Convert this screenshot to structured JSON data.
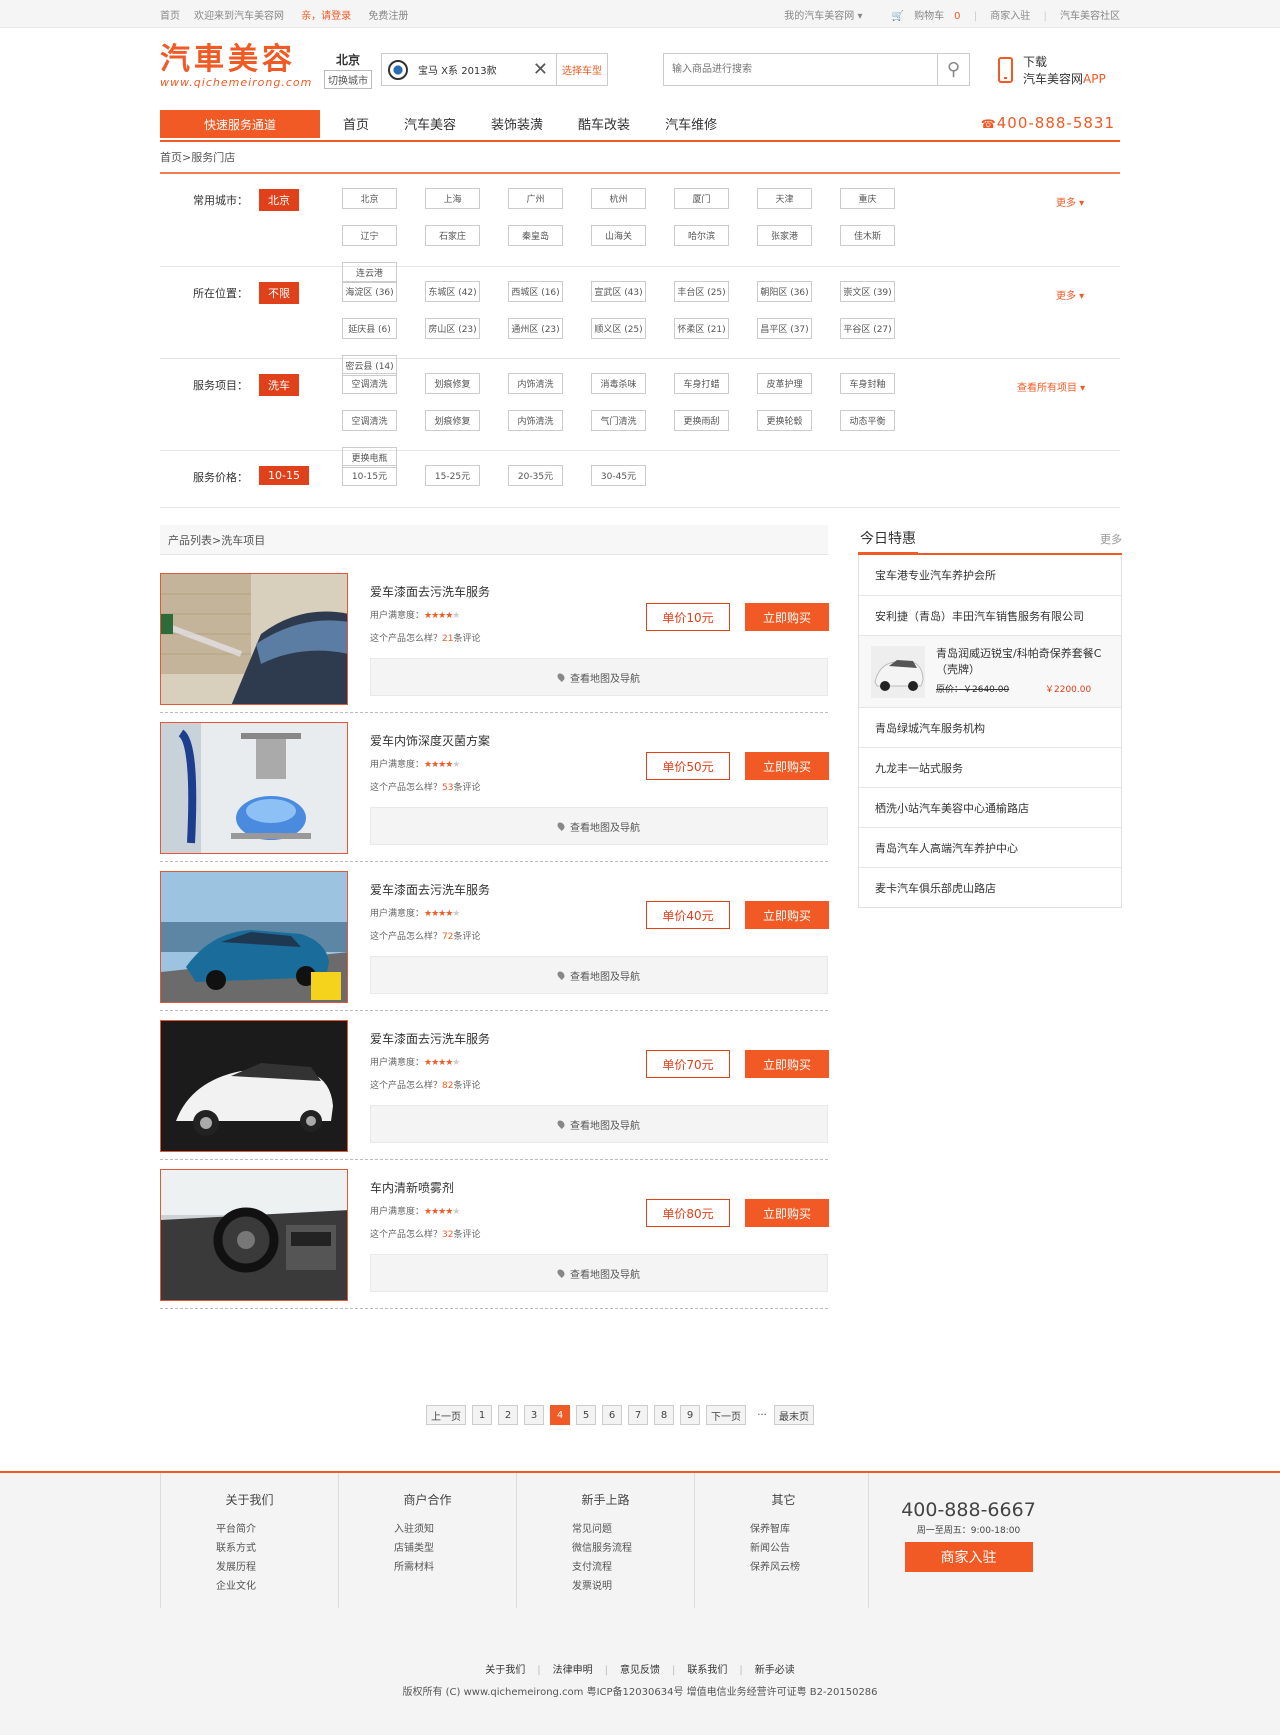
{
  "topbar": {
    "home": "首页",
    "welcome": "欢迎来到汽车美容网",
    "login": "亲，请登录",
    "register": "免费注册",
    "my_site": "我的汽车美容网",
    "cart": "购物车",
    "cart_count": "0",
    "merchant": "商家入驻",
    "community": "汽车美容社区"
  },
  "header": {
    "logo_text": "汽車美容",
    "logo_url": "www.qichemeirong.com",
    "city": "北京",
    "switch_city": "切换城市",
    "car": "宝马 X系 2013款",
    "choose_car": "选择车型",
    "search_placeholder": "输入商品进行搜索",
    "download": "下载",
    "app_name": "汽车美容网",
    "app_suffix": "APP"
  },
  "nav": {
    "quick": "快速服务通道",
    "items": [
      "首页",
      "汽车美容",
      "装饰装潢",
      "酷车改装",
      "汽车维修"
    ],
    "tel": "400-888-5831"
  },
  "breadcrumb": "首页>服务门店",
  "filters": {
    "city": {
      "label": "常用城市：",
      "active": "北京",
      "more": "更多",
      "opts": [
        "北京",
        "上海",
        "广州",
        "杭州",
        "厦门",
        "天津",
        "重庆",
        "辽宁",
        "石家庄",
        "秦皇岛",
        "山海关",
        "哈尔滨",
        "张家港",
        "佳木斯",
        "连云港"
      ]
    },
    "location": {
      "label": "所在位置：",
      "active": "不限",
      "more": "更多",
      "opts": [
        "海淀区 (36)",
        "东城区 (42)",
        "西城区 (16)",
        "宣武区 (43)",
        "丰台区 (25)",
        "朝阳区 (36)",
        "崇文区 (39)",
        "延庆县 (6)",
        "房山区 (23)",
        "通州区 (23)",
        "顺义区 (25)",
        "怀柔区 (21)",
        "昌平区 (37)",
        "平谷区 (27)",
        "密云县 (14)"
      ]
    },
    "service": {
      "label": "服务项目：",
      "active": "洗车",
      "more": "查看所有项目",
      "opts": [
        "空调清洗",
        "划痕修复",
        "内饰清洗",
        "消毒杀味",
        "车身打蜡",
        "皮革护理",
        "车身封釉",
        "空调清洗",
        "划痕修复",
        "内饰清洗",
        "气门清洗",
        "更换雨刮",
        "更换轮毂",
        "动态平衡",
        "更换电瓶"
      ]
    },
    "price": {
      "label": "服务价格：",
      "active": "10-15",
      "opts": [
        "10-15元",
        "15-25元",
        "20-35元",
        "30-45元"
      ]
    }
  },
  "list_title": "产品列表>洗车项目",
  "product_labels": {
    "satisfaction": "用户满意度：",
    "how": "这个产品怎么样？",
    "reviews_suffix": "条评论",
    "buy": "立即购买",
    "map": "查看地图及导航"
  },
  "products": [
    {
      "name": "爱车漆面去污洗车服务",
      "stars": 4,
      "reviews": "21",
      "price": "单价10元"
    },
    {
      "name": "爱车内饰深度灭菌方案",
      "stars": 4,
      "reviews": "53",
      "price": "单价50元"
    },
    {
      "name": "爱车漆面去污洗车服务",
      "stars": 4,
      "reviews": "72",
      "price": "单价40元"
    },
    {
      "name": "爱车漆面去污洗车服务",
      "stars": 4,
      "reviews": "82",
      "price": "单价70元"
    },
    {
      "name": "车内清新喷雾剂",
      "stars": 4,
      "reviews": "32",
      "price": "单价80元"
    }
  ],
  "pager": [
    "上一页",
    "1",
    "2",
    "3",
    "4",
    "5",
    "6",
    "7",
    "8",
    "9",
    "下一页",
    "···",
    "最末页"
  ],
  "pager_current": "4",
  "side": {
    "title": "今日特惠",
    "more": "更多",
    "items_top": [
      "宝车港专业汽车养护会所",
      "安利捷（青岛）丰田汽车销售服务有限公司"
    ],
    "feature": {
      "name": "青岛润威迈锐宝/科帕奇保养套餐C（壳牌）",
      "old": "原价：￥2640.00",
      "new": "￥2200.00"
    },
    "items_bottom": [
      "青岛绿城汽车服务机构",
      "九龙丰一站式服务",
      "栖洗小站汽车美容中心通榆路店",
      "青岛汽车人高端汽车养护中心",
      "麦卡汽车俱乐部虎山路店"
    ]
  },
  "footer": {
    "cols": [
      {
        "h": "关于我们",
        "items": [
          "平台简介",
          "联系方式",
          "发展历程",
          "企业文化"
        ]
      },
      {
        "h": "商户合作",
        "items": [
          "入驻须知",
          "店铺类型",
          "所需材料"
        ]
      },
      {
        "h": "新手上路",
        "items": [
          "常见问题",
          "微信服务流程",
          "支付流程",
          "发票说明"
        ]
      },
      {
        "h": "其它",
        "items": [
          "保养智库",
          "新闻公告",
          "保养风云榜"
        ]
      }
    ],
    "phone": "400-888-6667",
    "hours": "周一至周五：9:00-18:00",
    "join": "商家入驻",
    "links": [
      "关于我们",
      "法律申明",
      "意见反馈",
      "联系我们",
      "新手必读"
    ],
    "copyright": "版权所有 (C) www.qichemeirong.com 粤ICP备12030634号 增值电信业务经营许可证粤 B2-20150286"
  }
}
